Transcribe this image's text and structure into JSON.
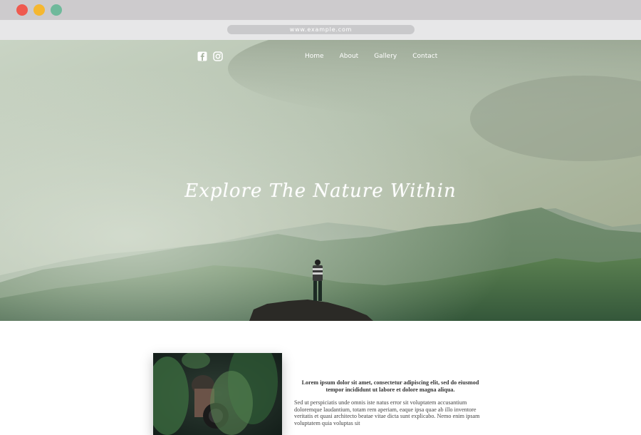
{
  "browser": {
    "url": "www.example.com",
    "window_controls": [
      "close",
      "minimize",
      "maximize"
    ]
  },
  "social": [
    {
      "icon": "facebook-icon"
    },
    {
      "icon": "instagram-icon"
    }
  ],
  "nav": {
    "items": [
      "Home",
      "About",
      "Gallery",
      "Contact"
    ]
  },
  "hero": {
    "title": "Explore The Nature Within"
  },
  "content": {
    "lead": "Lorem ipsum dolor sit amet, consectetur adipiscing elit, sed do eiusmod tempor incididunt ut labore et dolore magna aliqua.",
    "body": "Sed ut perspiciatis unde omnis iste natus error sit voluptatem accusantium doloremque laudantium, totam rem aperiam, eaque ipsa quae ab illo inventore veritatis et quasi architecto beatae vitae dicta sunt explicabo. Nemo enim ipsam voluptatem quia voluptas sit"
  },
  "colors": {
    "close": "#ef5a4f",
    "minimize": "#f5b730",
    "maximize": "#6fb99b"
  }
}
